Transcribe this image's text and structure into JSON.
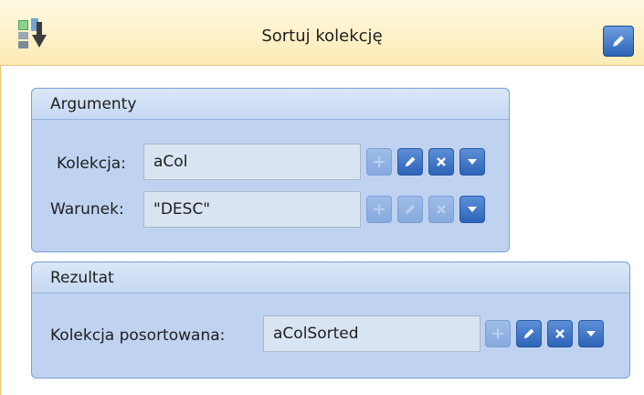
{
  "header": {
    "title": "Sortuj kolekcję"
  },
  "arguments": {
    "title": "Argumenty",
    "rows": [
      {
        "label": "Kolekcja:",
        "value": "aCol"
      },
      {
        "label": "Warunek:",
        "value": "\"DESC\""
      }
    ]
  },
  "result": {
    "title": "Rezultat",
    "label": "Kolekcja posortowana:",
    "value": "aColSorted"
  },
  "colors": {
    "accent": "#2d64b8",
    "header_bg": "#fdebb4",
    "panel_bg": "#bfd3f1"
  }
}
